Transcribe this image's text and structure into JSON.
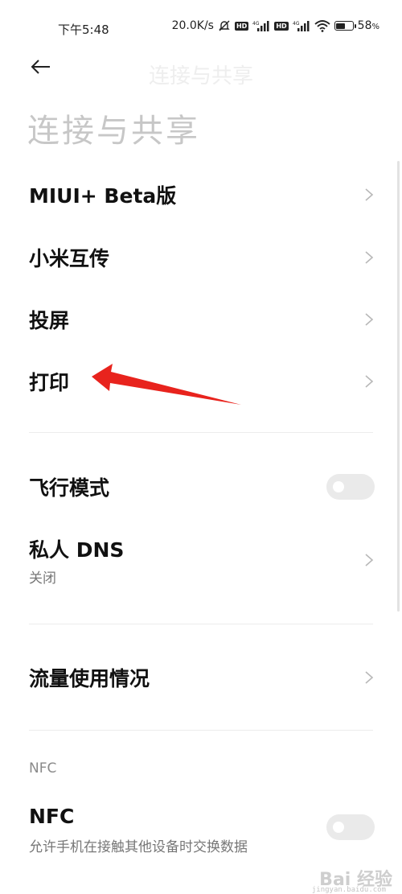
{
  "status_bar": {
    "time": "下午5:48",
    "network_speed": "20.0K/s",
    "signal1_label": "4G",
    "signal2_label": "4G",
    "hd_badge": "HD",
    "battery_percent": "58",
    "battery_level": 0.58,
    "battery_unit": "%"
  },
  "header": {
    "back_icon": "back-arrow-icon",
    "ghost_title": "连接与共享",
    "title": "连接与共享"
  },
  "items": [
    {
      "label": "MIUI+ Beta版"
    },
    {
      "label": "小米互传"
    },
    {
      "label": "投屏"
    },
    {
      "label": "打印"
    }
  ],
  "airplane": {
    "label": "飞行模式",
    "enabled": false
  },
  "private_dns": {
    "label": "私人 DNS",
    "sub": "关闭"
  },
  "data_usage": {
    "label": "流量使用情况"
  },
  "nfc_section": {
    "header": "NFC"
  },
  "nfc": {
    "label": "NFC",
    "sub": "允许手机在接触其他设备时交换数据",
    "enabled": false
  },
  "annotation": {
    "color": "#e8231d"
  },
  "watermark": {
    "text": "Bai 经验",
    "sub": "jingyan.baidu.com"
  }
}
